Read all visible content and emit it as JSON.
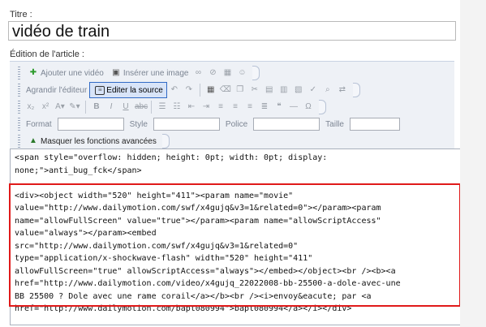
{
  "title_label": "Titre :",
  "title_value": "vidéo de train",
  "article_label": "Édition de l'article :",
  "toolbar": {
    "add_video": "Ajouter une vidéo",
    "insert_image": "Insérer une image",
    "enlarge_editor": "Agrandir l'éditeur",
    "edit_source": "Editer la source",
    "format_label": "Format",
    "style_label": "Style",
    "police_label": "Police",
    "taille_label": "Taille",
    "hide_advanced": "Masquer les fonctions avancées"
  },
  "editor_lines": [
    "<span style=\"overflow: hidden; height: 0pt; width: 0pt; display:",
    "none;\">anti_bug_fck</span>",
    "",
    "<div><object width=\"520\" height=\"411\"><param name=\"movie\"",
    "value=\"http://www.dailymotion.com/swf/x4gujq&v3=1&related=0\"></param><param",
    "name=\"allowFullScreen\" value=\"true\"></param><param name=\"allowScriptAccess\"",
    "value=\"always\"></param><embed",
    "src=\"http://www.dailymotion.com/swf/x4gujq&v3=1&related=0\"",
    "type=\"application/x-shockwave-flash\" width=\"520\" height=\"411\"",
    "allowFullScreen=\"true\" allowScriptAccess=\"always\"></embed></object><br /><b><a",
    "href=\"http://www.dailymotion.com/video/x4gujq_22022008-bb-25500-a-dole-avec-une",
    "BB 25500 ? Dole avec une rame corail</a></b><br /><i>envoy&eacute; par <a",
    "href=\"http://www.dailymotion.com/bapt080994\">bapt080994</a></i></div>"
  ]
}
